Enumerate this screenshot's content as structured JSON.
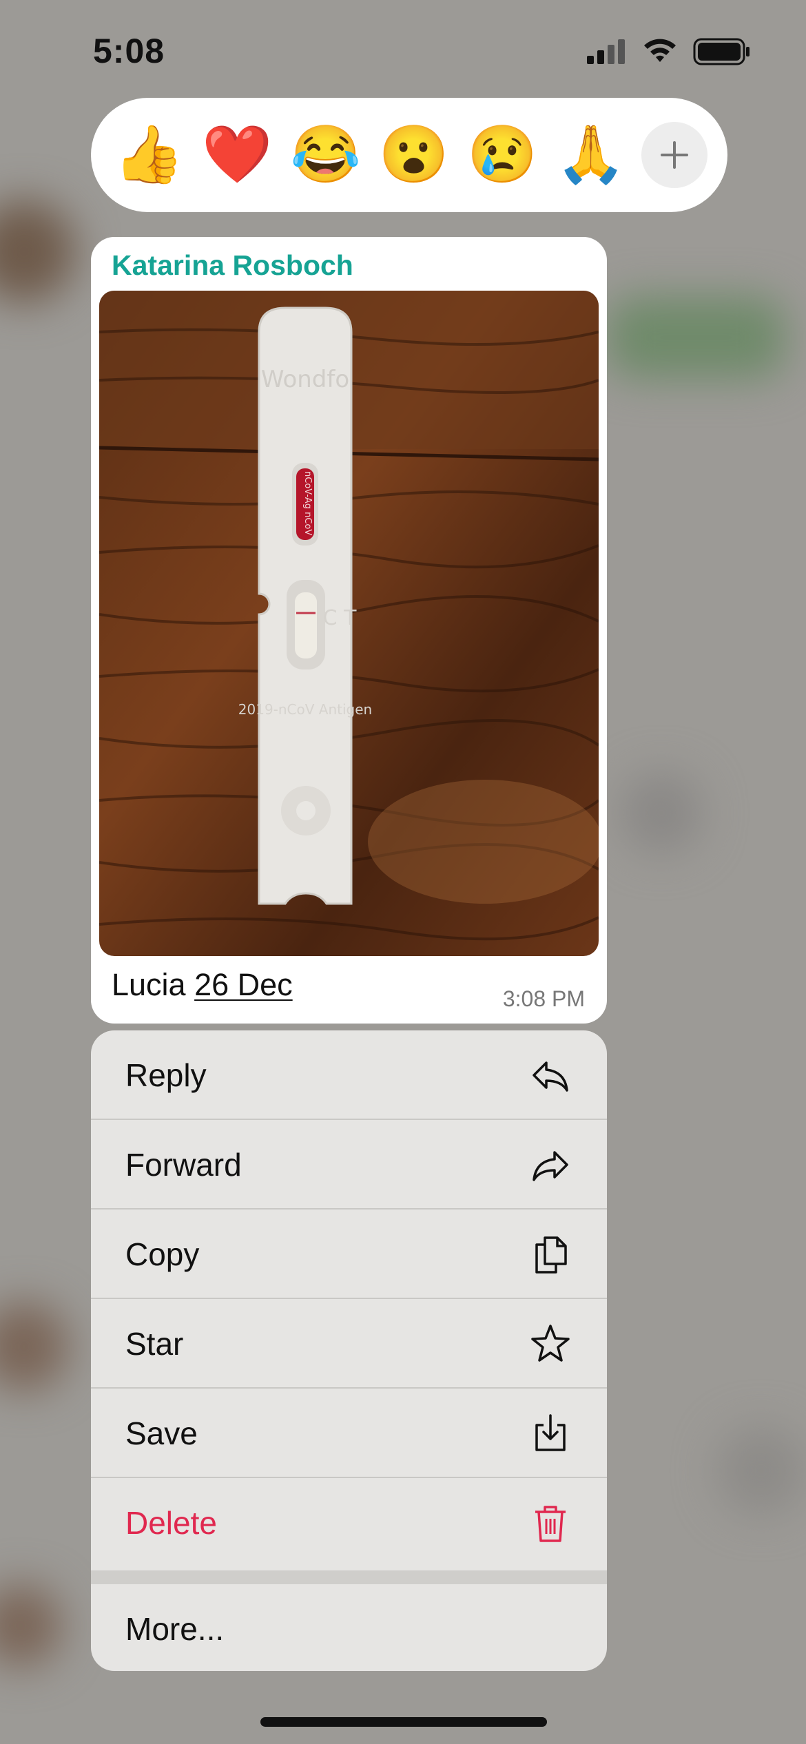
{
  "status_bar": {
    "time": "5:08",
    "signal_icon": "cellular-signal-icon",
    "wifi_icon": "wifi-icon",
    "battery_icon": "battery-icon"
  },
  "reactions": [
    {
      "emoji": "👍",
      "name": "thumbs-up"
    },
    {
      "emoji": "❤️",
      "name": "heart"
    },
    {
      "emoji": "😂",
      "name": "tears-of-joy"
    },
    {
      "emoji": "😮",
      "name": "surprised"
    },
    {
      "emoji": "😢",
      "name": "crying"
    },
    {
      "emoji": "🙏",
      "name": "folded-hands"
    }
  ],
  "reaction_more_icon": "plus-icon",
  "message": {
    "sender": "Katarina Rosboch",
    "caption_name": "Lucia",
    "caption_date": "26 Dec",
    "time": "3:08 PM",
    "photo": {
      "brand": "Wondfo",
      "reagent_text": "nCoV-Ag nCoV",
      "line_labels": "C T",
      "product_text": "2019-nCoV Antigen"
    }
  },
  "menu": {
    "items": [
      {
        "label": "Reply",
        "icon": "reply-icon"
      },
      {
        "label": "Forward",
        "icon": "forward-icon"
      },
      {
        "label": "Copy",
        "icon": "copy-icon"
      },
      {
        "label": "Star",
        "icon": "star-icon"
      },
      {
        "label": "Save",
        "icon": "save-icon"
      },
      {
        "label": "Delete",
        "icon": "trash-icon"
      }
    ],
    "more_label": "More..."
  },
  "colors": {
    "sender": "#16a394",
    "danger": "#e0284f",
    "bubble": "#ffffff",
    "menu_bg": "#e6e5e3"
  }
}
